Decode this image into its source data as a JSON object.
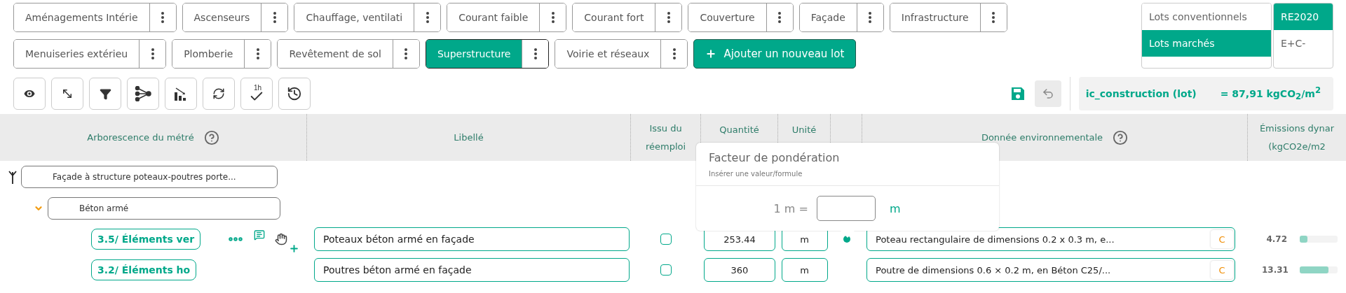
{
  "lots": [
    {
      "label": "Aménagements Intérie",
      "selected": false
    },
    {
      "label": "Ascenseurs",
      "selected": false
    },
    {
      "label": "Chauffage, ventilati",
      "selected": false
    },
    {
      "label": "Courant faible",
      "selected": false
    },
    {
      "label": "Courant fort",
      "selected": false
    },
    {
      "label": "Couverture",
      "selected": false
    },
    {
      "label": "Façade",
      "selected": false
    },
    {
      "label": "Infrastructure",
      "selected": false
    },
    {
      "label": "Menuiseries extérieu",
      "selected": false
    },
    {
      "label": "Plomberie",
      "selected": false
    },
    {
      "label": "Revêtement de sol",
      "selected": false
    },
    {
      "label": "Superstructure",
      "selected": true
    },
    {
      "label": "Voirie et réseaux",
      "selected": false
    }
  ],
  "add_lot_button": "Ajouter un nouveau lot",
  "lot_type_toggle": [
    {
      "label": "Lots conventionnels",
      "selected": false
    },
    {
      "label": "Lots marchés",
      "selected": true
    }
  ],
  "norm_toggle": [
    {
      "label": "RE2020",
      "selected": true
    },
    {
      "label": "E+C-",
      "selected": false
    }
  ],
  "toolbar": [
    {
      "kind": "view"
    },
    {
      "kind": "expand"
    },
    {
      "kind": "filter"
    },
    {
      "kind": "tree"
    },
    {
      "kind": "chart"
    },
    {
      "kind": "sync"
    },
    {
      "kind": "check",
      "label": "1h"
    },
    {
      "kind": "history"
    }
  ],
  "indicator": {
    "label": "ic_construction (lot)",
    "value": "= 87,91 kgCO$_{2}$/m$^{2}$"
  },
  "table": {
    "columns": [
      {
        "label": "Arborescence du métré",
        "help": true
      },
      {
        "label": "Libellé",
        "help": false
      },
      {
        "label": "Issu du réemploi",
        "help": false
      },
      {
        "label": "Quantité",
        "help": false
      },
      {
        "label": "Unité",
        "help": false
      },
      {
        "label": "Donnée environnementale",
        "help": true
      },
      {
        "label": "Émissions dynar (kgCO2e/m2",
        "help": false
      }
    ],
    "tree": [
      {
        "label": "Façade à structure poteaux-poutres porte...",
        "expanded": true,
        "children": [
          {
            "label": "Béton armé",
            "expanded": true,
            "children": [
              {
                "code": "3.5/ Éléments ver",
                "hovered": true,
                "libelle": "Poteaux béton armé en façade",
                "reuse": false,
                "quantity": "253.44",
                "unit": "m",
                "linked": true,
                "environmental_data": "Poteau rectangulaire de dimensions 0.2 x 0.3 m, e...",
                "badge": "C",
                "emissions": "4.72",
                "level": 0.2
              },
              {
                "code": "3.2/ Éléments ho",
                "hovered": false,
                "libelle": "Poutres béton armé en façade",
                "reuse": false,
                "quantity": "360",
                "unit": "m",
                "linked": false,
                "environmental_data": "Poutre de dimensions 0.6 × 0.2 m, en Béton C25/...",
                "badge": "C",
                "emissions": "13.31",
                "level": 0.75
              }
            ]
          }
        ]
      }
    ]
  },
  "popover": {
    "title": "Facteur de pondération",
    "subtitle": "Insérer une valeur/formule",
    "prefix": "1 m =",
    "unit": "m"
  }
}
